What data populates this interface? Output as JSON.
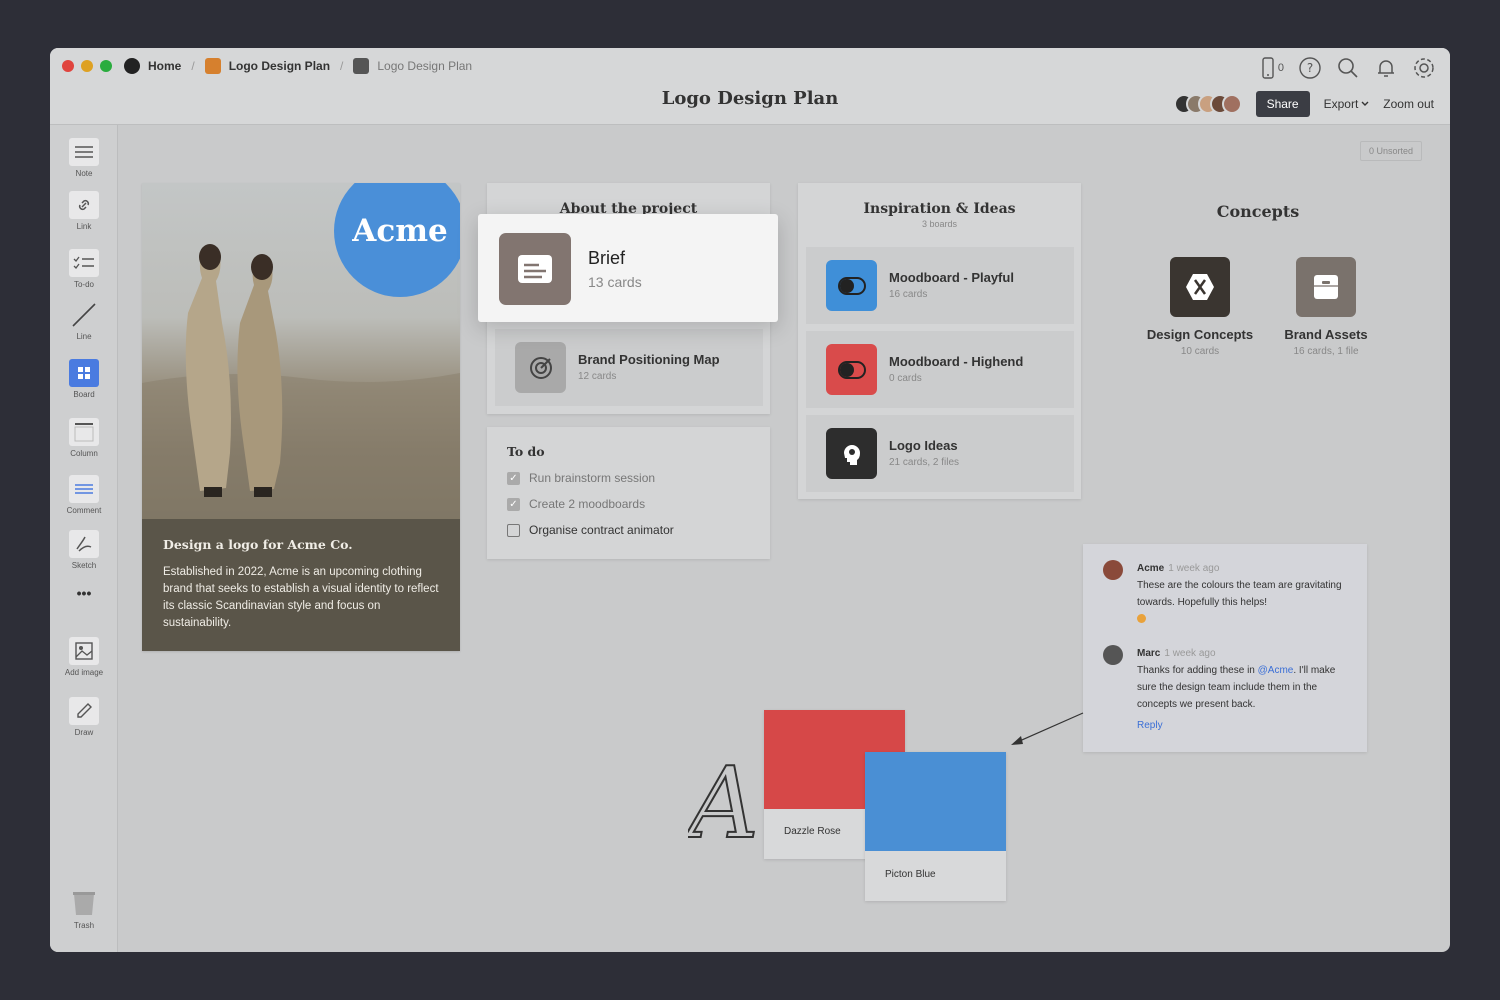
{
  "breadcrumbs": [
    {
      "label": "Home"
    },
    {
      "label": "Logo Design Plan"
    },
    {
      "label": "Logo Design Plan"
    }
  ],
  "header": {
    "title": "Logo Design Plan",
    "device_count": "0",
    "share_label": "Share",
    "export_label": "Export",
    "zoom_label": "Zoom out"
  },
  "toolbar": {
    "items": [
      {
        "label": "Note",
        "icon": "note-icon"
      },
      {
        "label": "Link",
        "icon": "link-icon"
      },
      {
        "label": "To-do",
        "icon": "todo-icon"
      },
      {
        "label": "Line",
        "icon": "line-icon"
      },
      {
        "label": "Board",
        "icon": "board-icon"
      },
      {
        "label": "Column",
        "icon": "column-icon"
      },
      {
        "label": "Comment",
        "icon": "comment-icon"
      },
      {
        "label": "Sketch",
        "icon": "sketch-icon"
      },
      {
        "label": "Add image",
        "icon": "add-image-icon"
      },
      {
        "label": "Draw",
        "icon": "draw-icon"
      },
      {
        "label": "Trash",
        "icon": "trash-icon"
      }
    ],
    "more_label": "•••"
  },
  "canvas": {
    "unsorted_label": "0 Unsorted",
    "acme_card": {
      "logo_text": "Acme",
      "heading": "Design a logo for Acme Co.",
      "body": "Established in 2022, Acme is an upcoming clothing brand that seeks to establish a visual identity to reflect its classic Scandinavian style and focus on sustainability."
    },
    "about": {
      "title": "About the project",
      "brief": {
        "name": "Brief",
        "count": "13 cards"
      },
      "positioning": {
        "name": "Brand Positioning Map",
        "count": "12 cards"
      }
    },
    "todo": {
      "title": "To do",
      "items": [
        {
          "text": "Run brainstorm session",
          "checked": true
        },
        {
          "text": "Create 2 moodboards",
          "checked": true
        },
        {
          "text": "Organise contract animator",
          "checked": false
        }
      ]
    },
    "inspiration": {
      "title": "Inspiration & Ideas",
      "subtitle": "3 boards",
      "boards": [
        {
          "name": "Moodboard - Playful",
          "count": "16 cards",
          "color": "#3f8fd8"
        },
        {
          "name": "Moodboard - Highend",
          "count": "0 cards",
          "color": "#d94b4b"
        },
        {
          "name": "Logo Ideas",
          "count": "21 cards, 2 files",
          "color": "#2d2d2d"
        }
      ]
    },
    "concepts": {
      "title": "Concepts",
      "items": [
        {
          "name": "Design Concepts",
          "count": "10 cards",
          "color": "#3a3530"
        },
        {
          "name": "Brand Assets",
          "count": "16 cards, 1 file",
          "color": "#7a726c"
        }
      ]
    },
    "swatches": [
      {
        "label": "Dazzle Rose",
        "color": "#d64848"
      },
      {
        "label": "Picton Blue",
        "color": "#4a8fd4"
      }
    ],
    "comments": [
      {
        "author": "Acme",
        "time": "1 week ago",
        "text": "These are the colours the team are gravitating towards. Hopefully this helps!"
      },
      {
        "author": "Marc",
        "time": "1 week ago",
        "text_before": "Thanks for adding these in ",
        "mention": "@Acme",
        "text_after": ". I'll make sure the design team include them in the concepts we present back."
      }
    ],
    "reply_label": "Reply"
  }
}
